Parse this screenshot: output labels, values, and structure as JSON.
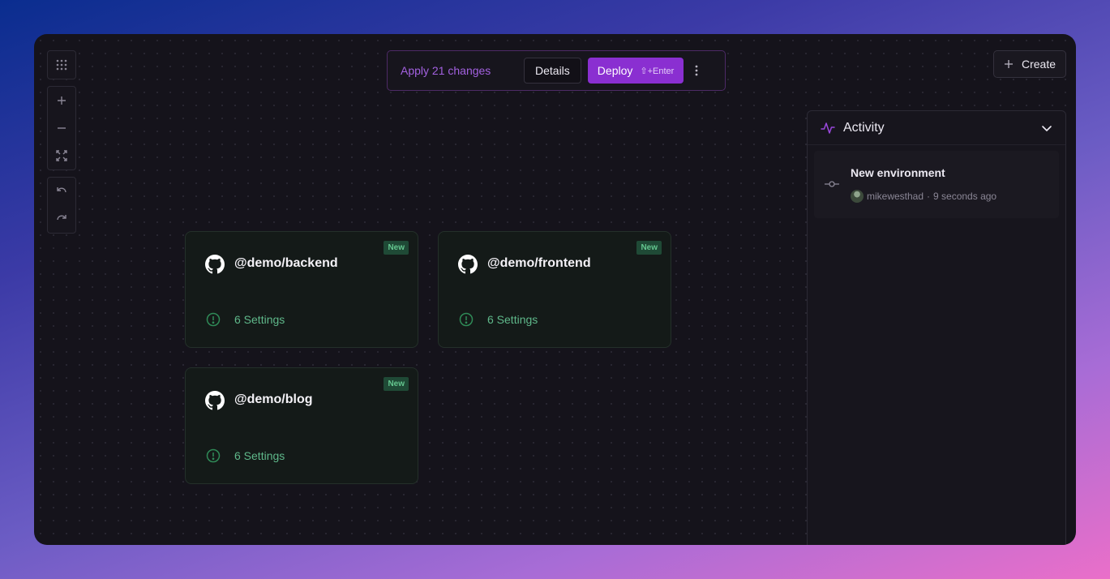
{
  "toolbar": {
    "icons": [
      "grid-icon",
      "zoom-in-icon",
      "zoom-out-icon",
      "fit-view-icon",
      "undo-icon",
      "redo-icon"
    ]
  },
  "deploy_bar": {
    "apply_label": "Apply 21 changes",
    "details_label": "Details",
    "deploy_label": "Deploy",
    "deploy_shortcut": "⇧+Enter"
  },
  "create": {
    "label": "Create"
  },
  "services": [
    {
      "name": "@demo/backend",
      "badge": "New",
      "status": "6 Settings"
    },
    {
      "name": "@demo/frontend",
      "badge": "New",
      "status": "6 Settings"
    },
    {
      "name": "@demo/blog",
      "badge": "New",
      "status": "6 Settings"
    }
  ],
  "activity": {
    "title": "Activity",
    "items": [
      {
        "title": "New environment",
        "user": "mikewesthad",
        "time": "9 seconds ago"
      }
    ]
  },
  "colors": {
    "accent": "#8a2fd1",
    "background": "#15131b",
    "success": "#5fb88a"
  }
}
